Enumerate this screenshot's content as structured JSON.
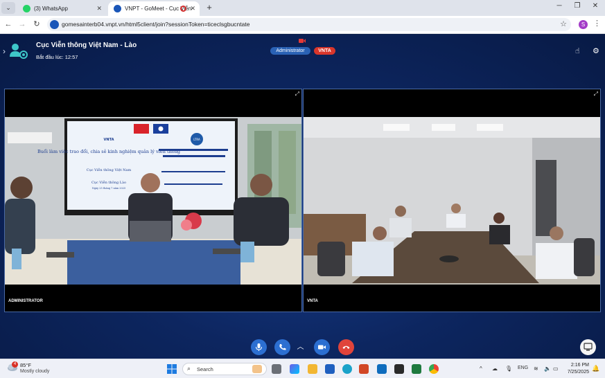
{
  "browser": {
    "tabs": [
      {
        "label": "(3) WhatsApp",
        "active": false
      },
      {
        "label": "VNPT - GoMeet - Cục Viễn",
        "active": true
      }
    ],
    "url": "gomesainterb04.vnpt.vn/html5client/join?sessionToken=ticeclsgbucntate",
    "profile_initial": "S"
  },
  "meeting": {
    "title": "Cục Viễn thông Việt Nam - Lào",
    "start_time": "Bắt đầu lúc: 12:57",
    "badges": {
      "role": "Administrator",
      "org": "VNTA"
    },
    "tiles": [
      {
        "label": "ADMINISTRATOR"
      },
      {
        "label": "VNTA"
      }
    ],
    "screen_text": {
      "vn_heading": "Buổi làm việc trao đổi, chia sẻ kinh nghiệm quản lý viễn thông",
      "vn_line2": "Cục Viễn thông Việt Nam",
      "vn_line3": "Cục Viễn thông Lào",
      "vn_date": "Ngày 25 tháng 7 năm 2025",
      "logo_left": "VNTA",
      "logo_right": "LTRA"
    }
  },
  "taskbar": {
    "temp": "85°F",
    "weather": "Mostly cloudy",
    "weather_badge": "4",
    "search_placeholder": "Search",
    "lang": "ENG",
    "time": "2:16 PM",
    "date": "7/25/2025"
  },
  "colors": {
    "meet_bg": "#0d2660",
    "control_blue": "#2c6fd1",
    "leave_red": "#e0443b",
    "badge_red": "#d9362b"
  }
}
